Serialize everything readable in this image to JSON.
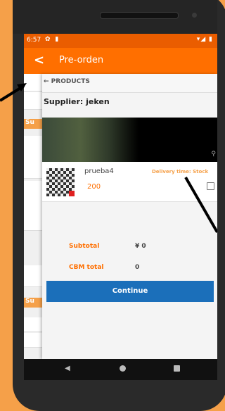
{
  "status_bar": {
    "time": "6:57",
    "left_icons": "✿ ▮",
    "right_icons": "▾◢ ▮"
  },
  "app_bar": {
    "back_icon": "back-arrow-icon",
    "title": "Pre-orden"
  },
  "background_sections": [
    "Su",
    "Su"
  ],
  "modal": {
    "back_link": "← PRODUCTS",
    "supplier": "Supplier: jeken",
    "product": {
      "name": "prueba4",
      "quantity": "200",
      "delivery": "Delivery time: Stock"
    },
    "subtotal_label": "Subtotal",
    "subtotal_value": "¥ 0",
    "cbm_label": "CBM total",
    "cbm_value": "0",
    "continue_label": "Continue"
  },
  "nav": {
    "back": "◀"
  },
  "colors": {
    "accent": "#ff6f00",
    "status": "#ea5d00",
    "button": "#1b6fba",
    "background": "#f5a049"
  }
}
